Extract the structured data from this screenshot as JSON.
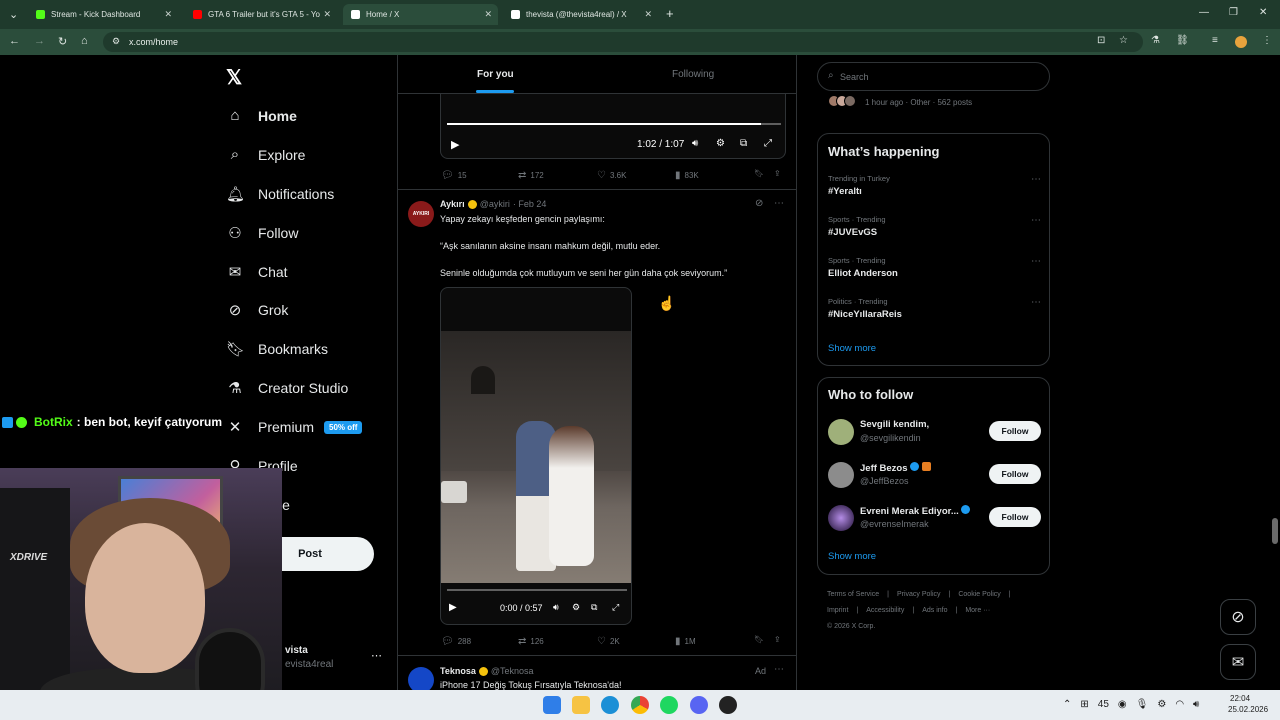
{
  "browser": {
    "tabs": [
      {
        "title": "Stream - Kick Dashboard",
        "color": "#53fc18"
      },
      {
        "title": "GTA 6 Trailer but it's GTA 5 - Yo",
        "color": "#ff0000"
      },
      {
        "title": "Home / X",
        "color": "#ffffff"
      },
      {
        "title": "thevista (@thevista4real) / X",
        "color": "#ffffff"
      }
    ],
    "url": "x.com/home"
  },
  "nav": {
    "items": [
      {
        "label": "Home",
        "icon": "home-icon"
      },
      {
        "label": "Explore",
        "icon": "search-icon"
      },
      {
        "label": "Notifications",
        "icon": "bell-icon"
      },
      {
        "label": "Follow",
        "icon": "person-add-icon"
      },
      {
        "label": "Chat",
        "icon": "mail-icon"
      },
      {
        "label": "Grok",
        "icon": "grok-icon"
      },
      {
        "label": "Bookmarks",
        "icon": "bookmark-icon"
      },
      {
        "label": "Creator Studio",
        "icon": "flask-icon"
      },
      {
        "label": "Premium",
        "icon": "x-icon"
      },
      {
        "label": "Profile",
        "icon": "person-icon"
      },
      {
        "label": "More",
        "icon": "more-icon"
      }
    ],
    "premium_badge": "50% off",
    "post_button": "Post",
    "profile_name": "vista",
    "profile_handle": "evista4real"
  },
  "chat_overlay": {
    "user": "BotRix",
    "message": ": ben bot, keyif çatıyorum"
  },
  "webcam": {
    "brand": "XDRIVE"
  },
  "feed": {
    "tabs": [
      "For you",
      "Following"
    ],
    "post1": {
      "video_time": "1:02 / 1:07",
      "progress": 0.94,
      "replies": "15",
      "reposts": "172",
      "likes": "3.6K",
      "views": "83K"
    },
    "post2": {
      "name": "Aykırı",
      "handle": "@aykiri",
      "date": "· Feb 24",
      "avatar_text": "AYKIRI",
      "line1": "Yapay zekayı keşfeden gencin paylaşımı:",
      "line2": "“Aşk sanılanın aksine insanı mahkum değil, mutlu eder.",
      "line3": "Seninle olduğumda çok mutluyum ve seni her gün daha çok seviyorum.”",
      "video_time": "0:00 / 0:57",
      "replies": "288",
      "reposts": "126",
      "likes": "2K",
      "views": "1M"
    },
    "post3": {
      "name": "Teknosa",
      "handle": "@Teknosa",
      "ad": "Ad",
      "text": "iPhone 17 Değiş Tokuş Fırsatıyla Teknosa'da!"
    }
  },
  "right": {
    "search_placeholder": "Search",
    "top_meta": "1 hour ago · Other · 562 posts",
    "happening_title": "What’s happening",
    "trends": [
      {
        "meta": "Trending in Turkey",
        "name": "#Yeraltı"
      },
      {
        "meta": "Sports · Trending",
        "name": "#JUVEvGS"
      },
      {
        "meta": "Sports · Trending",
        "name": "Elliot Anderson"
      },
      {
        "meta": "Politics · Trending",
        "name": "#NiceYıllaraReis"
      }
    ],
    "show_more": "Show more",
    "who_title": "Who to follow",
    "who": [
      {
        "name": "Sevgili kendim,",
        "handle": "@sevgilikendin",
        "button": "Follow"
      },
      {
        "name": "Jeff Bezos",
        "handle": "@JeffBezos",
        "button": "Follow"
      },
      {
        "name": "Evreni Merak Ediyor...",
        "handle": "@evrenseImerak",
        "button": "Follow"
      }
    ],
    "footer": [
      "Terms of Service",
      "|",
      "Privacy Policy",
      "|",
      "Cookie Policy",
      "|",
      "Imprint",
      "|",
      "Accessibility",
      "|",
      "Ads info",
      "|",
      "More ···",
      "© 2026 X Corp."
    ]
  },
  "taskbar": {
    "tray_count": "45",
    "time": "22:04",
    "date": "25.02.2026"
  }
}
